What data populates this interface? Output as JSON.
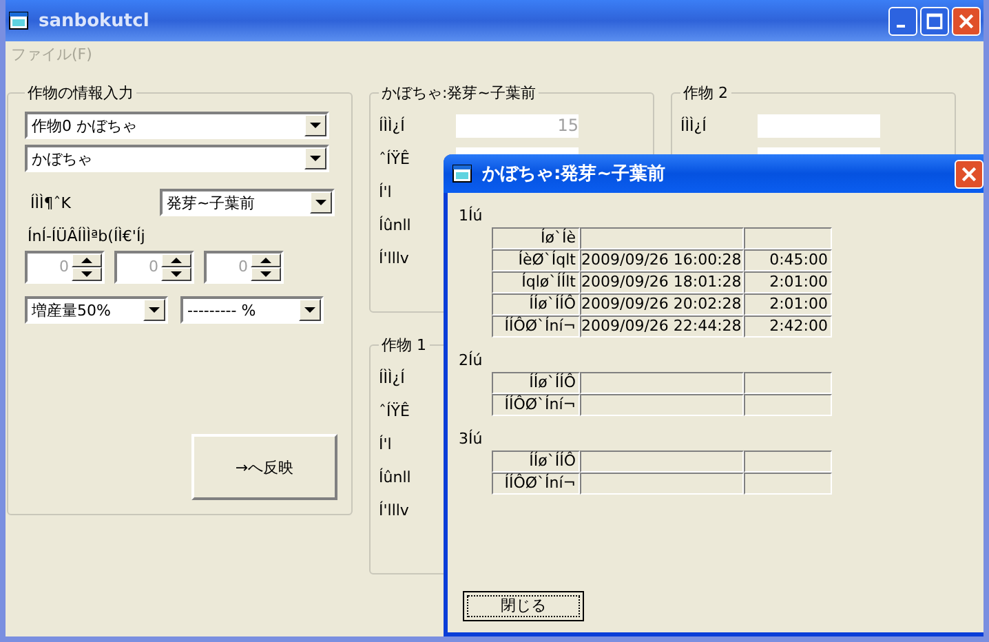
{
  "window": {
    "title": "sanbokutcl"
  },
  "menu": [
    "ファイル(F)"
  ],
  "input_group": {
    "title": "作物の情報入力",
    "crop_select": "作物0 かぼちゃ",
    "variety_select": "かぼちゃ",
    "stage_label": "ÍÌÌ¶ˆK",
    "stage_select": "発芽~子葉前",
    "offset_label": "ÍnÍ-ÍÜÂÍÌÌªb(ÍÌ€'Íj",
    "spinners": [
      "0",
      "0",
      "0"
    ],
    "yield_select": "増産量50%",
    "percent_select": "--------- %",
    "apply_button": "→へ反映"
  },
  "stage_group": {
    "title": "かぼちゃ:発芽~子葉前",
    "rows": [
      {
        "label": "ÍÌÌ¿Í",
        "kind": "field",
        "value": "15"
      },
      {
        "label": "ˆÍŸÊ",
        "kind": "field"
      },
      {
        "label": "Í'l"
      },
      {
        "label": "Íûnll"
      },
      {
        "label": "Í'lllv"
      }
    ]
  },
  "crop2_group": {
    "title": "作物 2",
    "rows": [
      {
        "label": "ÍÌÌ¿Í",
        "kind": "field"
      },
      {
        "kind": "field"
      }
    ]
  },
  "crop1_group": {
    "title": "作物 1",
    "rows": [
      {
        "label": "ÍÌÌ¿Í"
      },
      {
        "label": "ˆÍŸÊ"
      },
      {
        "label": "Í'l"
      },
      {
        "label": "Íûnll"
      },
      {
        "label": "Í'lllv"
      }
    ]
  },
  "dialog": {
    "title": "かぼちゃ:発芽~子葉前",
    "days": [
      {
        "label": "1Íú",
        "rows": [
          {
            "label": "Íø`Íè"
          },
          {
            "label": "ÍèØ`Íqlt",
            "time": "2009/09/26 16:00:28",
            "duration": "0:45:00"
          },
          {
            "label": "Íqlø`ÍÍlt",
            "time": "2009/09/26 18:01:28",
            "duration": "2:01:00"
          },
          {
            "label": "ÍÍø`ÍÍÔ",
            "time": "2009/09/26 20:02:28",
            "duration": "2:01:00"
          },
          {
            "label": "ÍÍÔØ`Íní¬",
            "time": "2009/09/26 22:44:28",
            "duration": "2:42:00"
          }
        ]
      },
      {
        "label": "2Íú",
        "rows": [
          {
            "label": "ÍÍø`ÍÍÔ"
          },
          {
            "label": "ÍÍÔØ`Íní¬"
          }
        ]
      },
      {
        "label": "3Íú",
        "rows": [
          {
            "label": "ÍÍø`ÍÍÔ"
          },
          {
            "label": "ÍÍÔØ`Íní¬"
          }
        ]
      }
    ],
    "close_button": "閉じる"
  }
}
